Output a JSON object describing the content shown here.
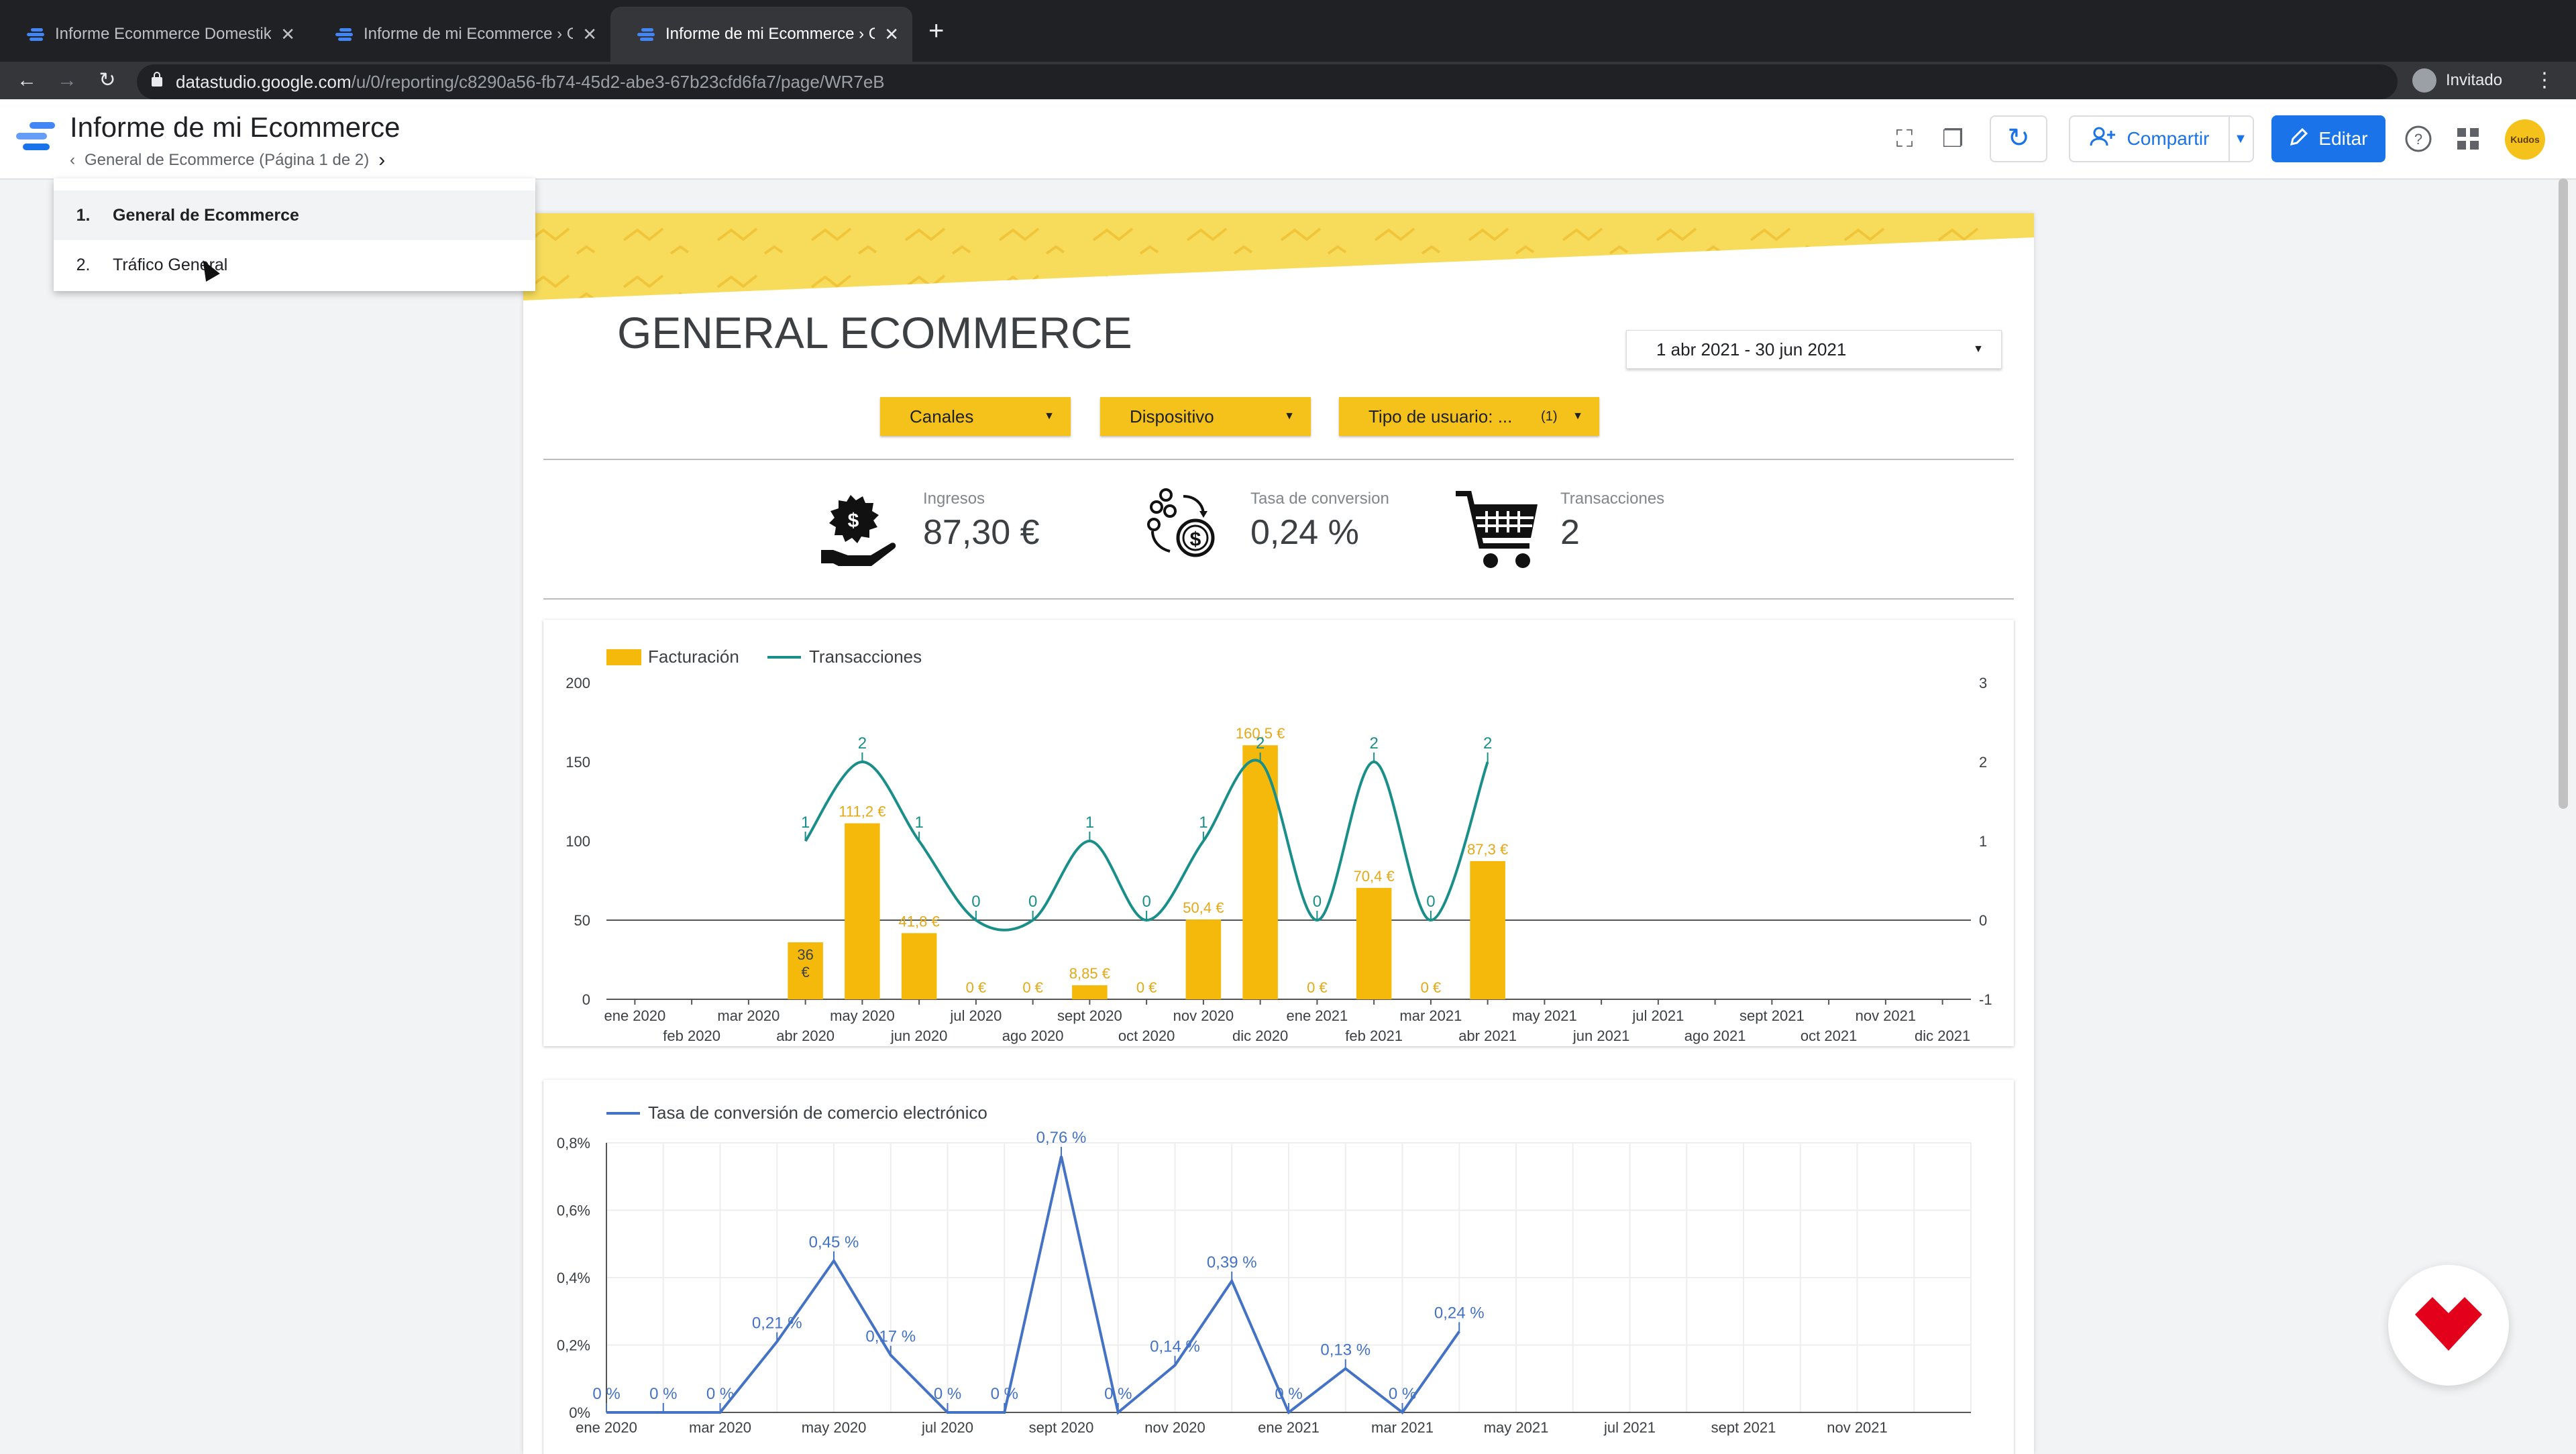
{
  "browser": {
    "tabs": [
      {
        "title": "Informe Ecommerce Domestika"
      },
      {
        "title": "Informe de mi Ecommerce › Ge"
      },
      {
        "title": "Informe de mi Ecommerce › Ge"
      }
    ],
    "url_host": "datastudio.google.com",
    "url_path": "/u/0/reporting/c8290a56-fb74-45d2-abe3-67b23cfd6fa7/page/WR7eB",
    "profile_label": "Invitado"
  },
  "header": {
    "report_title": "Informe de mi Ecommerce",
    "page_crumb": "General de Ecommerce (Página 1 de 2)",
    "share_label": "Compartir",
    "edit_label": "Editar",
    "avatar_text": "Kudos"
  },
  "page_menu": {
    "items": [
      {
        "num": "1.",
        "label": "General de Ecommerce"
      },
      {
        "num": "2.",
        "label": "Tráfico General"
      }
    ]
  },
  "report": {
    "title": "GENERAL ECOMMERCE",
    "date_range": "1 abr 2021 - 30 jun 2021",
    "filters": [
      {
        "label": "Canales",
        "badge": ""
      },
      {
        "label": "Dispositivo",
        "badge": ""
      },
      {
        "label": "Tipo de usuario: ...",
        "badge": "(1)"
      }
    ],
    "kpis": [
      {
        "label": "Ingresos",
        "value": "87,30 €",
        "icon": "money-hand-icon"
      },
      {
        "label": "Tasa de conversion",
        "value": "0,24 %",
        "icon": "conversion-icon"
      },
      {
        "label": "Transacciones",
        "value": "2",
        "icon": "shopping-cart-icon"
      }
    ]
  },
  "colors": {
    "accent_yellow": "#f4c21a",
    "bar": "#f4b90a",
    "line_teal": "#1a8f8a",
    "line_blue": "#4472c4",
    "edit_blue": "#1a73e8"
  },
  "chart_data": [
    {
      "type": "bar",
      "legend": [
        "Facturación",
        "Transacciones"
      ],
      "x_top": [
        "ene 2020",
        "mar 2020",
        "may 2020",
        "jul 2020",
        "sept 2020",
        "nov 2020",
        "ene 2021",
        "mar 2021",
        "may 2021",
        "jul 2021",
        "sept 2021",
        "nov 2021"
      ],
      "x_bottom": [
        "feb 2020",
        "abr 2020",
        "jun 2020",
        "ago 2020",
        "oct 2020",
        "dic 2020",
        "feb 2021",
        "abr 2021",
        "jun 2021",
        "ago 2021",
        "oct 2021",
        "dic 2021"
      ],
      "categories": [
        "ene 2020",
        "feb 2020",
        "mar 2020",
        "abr 2020",
        "may 2020",
        "jun 2020",
        "jul 2020",
        "ago 2020",
        "sept 2020",
        "oct 2020",
        "nov 2020",
        "dic 2020",
        "ene 2021",
        "feb 2021",
        "mar 2021",
        "abr 2021",
        "may 2021",
        "jun 2021",
        "jul 2021",
        "ago 2021",
        "sept 2021",
        "oct 2021",
        "nov 2021",
        "dic 2021"
      ],
      "yticks_left": [
        "200",
        "150",
        "100",
        "50",
        "0"
      ],
      "yticks_right": [
        "3",
        "2",
        "1",
        "0",
        "-1"
      ],
      "ylim_left": [
        0,
        200
      ],
      "ylim_right": [
        -1,
        3
      ],
      "series": [
        {
          "name": "Facturación",
          "bars": [
            {
              "month_index": 3,
              "value": 36,
              "label": "36 €",
              "inside": true
            },
            {
              "month_index": 4,
              "value": 111.2,
              "label": "111,2 €"
            },
            {
              "month_index": 5,
              "value": 41.8,
              "label": "41,8 €"
            },
            {
              "month_index": 6,
              "value": 0,
              "label": "0 €"
            },
            {
              "month_index": 7,
              "value": 0,
              "label": "0 €"
            },
            {
              "month_index": 8,
              "value": 8.85,
              "label": "8,85 €"
            },
            {
              "month_index": 9,
              "value": 0,
              "label": "0 €"
            },
            {
              "month_index": 10,
              "value": 50.4,
              "label": "50,4 €"
            },
            {
              "month_index": 11,
              "value": 160.5,
              "label": "160,5 €"
            },
            {
              "month_index": 12,
              "value": 0,
              "label": "0 €"
            },
            {
              "month_index": 13,
              "value": 70.4,
              "label": "70,4 €"
            },
            {
              "month_index": 14,
              "value": 0,
              "label": "0 €"
            },
            {
              "month_index": 15,
              "value": 87.3,
              "label": "87,3 €"
            }
          ]
        },
        {
          "name": "Transacciones",
          "points": [
            {
              "month_index": 3,
              "value": 1,
              "label": "1"
            },
            {
              "month_index": 4,
              "value": 2,
              "label": "2"
            },
            {
              "month_index": 5,
              "value": 1,
              "label": "1"
            },
            {
              "month_index": 6,
              "value": 0,
              "label": "0"
            },
            {
              "month_index": 7,
              "value": 0,
              "label": "0"
            },
            {
              "month_index": 8,
              "value": 1,
              "label": "1"
            },
            {
              "month_index": 9,
              "value": 0,
              "label": "0"
            },
            {
              "month_index": 10,
              "value": 1,
              "label": "1"
            },
            {
              "month_index": 11,
              "value": 2,
              "label": "2"
            },
            {
              "month_index": 12,
              "value": 0,
              "label": "0"
            },
            {
              "month_index": 13,
              "value": 2,
              "label": "2"
            },
            {
              "month_index": 14,
              "value": 0,
              "label": "0"
            },
            {
              "month_index": 15,
              "value": 2,
              "label": "2"
            }
          ]
        }
      ]
    },
    {
      "type": "line",
      "legend": [
        "Tasa de conversión de comercio electrónico"
      ],
      "yticks": [
        "0,8%",
        "0,6%",
        "0,4%",
        "0,2%",
        "0%"
      ],
      "ylim": [
        0,
        0.8
      ],
      "x_top": [
        "ene 2020",
        "mar 2020",
        "may 2020",
        "jul 2020",
        "sept 2020",
        "nov 2020",
        "ene 2021",
        "mar 2021",
        "may 2021",
        "jul 2021",
        "sept 2021",
        "nov 2021"
      ],
      "series": [
        {
          "name": "Tasa de conversión de comercio electrónico",
          "points": [
            {
              "month_index": 0,
              "value": 0,
              "label": "0 %"
            },
            {
              "month_index": 1,
              "value": 0,
              "label": "0 %"
            },
            {
              "month_index": 2,
              "value": 0,
              "label": "0 %"
            },
            {
              "month_index": 3,
              "value": 0.21,
              "label": "0,21 %"
            },
            {
              "month_index": 4,
              "value": 0.45,
              "label": "0,45 %"
            },
            {
              "month_index": 5,
              "value": 0.17,
              "label": "0,17 %"
            },
            {
              "month_index": 6,
              "value": 0,
              "label": "0 %"
            },
            {
              "month_index": 7,
              "value": 0,
              "label": "0 %"
            },
            {
              "month_index": 8,
              "value": 0.76,
              "label": "0,76 %"
            },
            {
              "month_index": 9,
              "value": 0,
              "label": "0 %"
            },
            {
              "month_index": 10,
              "value": 0.14,
              "label": "0,14 %"
            },
            {
              "month_index": 11,
              "value": 0.39,
              "label": "0,39 %"
            },
            {
              "month_index": 12,
              "value": 0,
              "label": "0 %"
            },
            {
              "month_index": 13,
              "value": 0.13,
              "label": "0,13 %"
            },
            {
              "month_index": 14,
              "value": 0,
              "label": "0 %"
            },
            {
              "month_index": 15,
              "value": 0.24,
              "label": "0,24 %"
            }
          ]
        }
      ]
    }
  ]
}
